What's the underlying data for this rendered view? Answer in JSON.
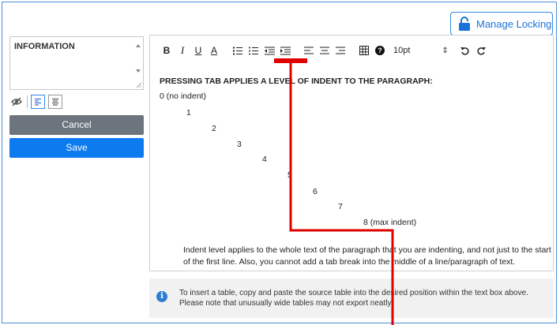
{
  "header": {
    "lock_button_label": "Manage Locking",
    "lock_icon": "unlock-icon"
  },
  "sidebar": {
    "field_label": "INFORMATION",
    "tool_icons": [
      "eye-slash-icon",
      "align-left-icon",
      "align-justify-icon"
    ],
    "cancel_label": "Cancel",
    "save_label": "Save"
  },
  "toolbar": {
    "bold": "B",
    "italic": "I",
    "underline": "U",
    "color": "A",
    "icons": [
      "ordered-list-icon",
      "unordered-list-icon",
      "outdent-icon",
      "indent-icon",
      "align-left-icon",
      "align-center-icon",
      "align-right-icon",
      "table-icon",
      "help-icon",
      "undo-icon",
      "redo-icon"
    ],
    "font_size": "10pt",
    "font_size_spinner": "⇕"
  },
  "editor": {
    "heading": "PRESSING TAB APPLIES A LEVEL OF INDENT TO THE PARAGRAPH:",
    "levels": [
      "0 (no indent)",
      "1",
      "2",
      "3",
      "4",
      "5",
      "6",
      "7",
      "8 (max indent)"
    ],
    "paragraph": "Indent level applies to the whole text of the paragraph that you are indenting, and not just to the start of the first line. Also, you cannot add a tab break into the middle of a line/paragraph of text."
  },
  "note": {
    "icon": "info-icon",
    "text": "To insert a table, copy and paste the source table into the desired position within the text box above. Please note that unusually wide tables may not export neatly."
  },
  "annotation": {
    "color": "#e00000"
  }
}
